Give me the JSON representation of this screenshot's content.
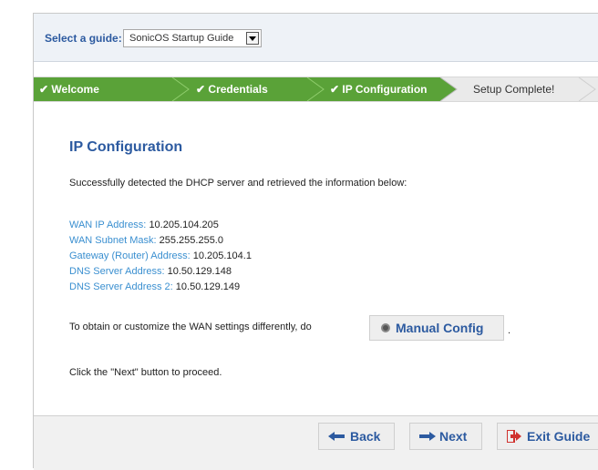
{
  "guide": {
    "label": "Select a guide:",
    "selected": "SonicOS Startup Guide"
  },
  "steps": [
    {
      "label": "Welcome",
      "status": "done"
    },
    {
      "label": "Credentials",
      "status": "done"
    },
    {
      "label": "IP Configuration",
      "status": "done"
    },
    {
      "label": "Setup Complete!",
      "status": "todo"
    }
  ],
  "check": "✔",
  "content": {
    "title": "IP Configuration",
    "intro": "Successfully detected the DHCP server and retrieved the information below:",
    "fields": [
      {
        "label": "WAN IP Address:",
        "value": "10.205.104.205"
      },
      {
        "label": "WAN Subnet Mask:",
        "value": "255.255.255.0"
      },
      {
        "label": "Gateway (Router) Address:",
        "value": "10.205.104.1"
      },
      {
        "label": "DNS Server Address:",
        "value": "10.50.129.148"
      },
      {
        "label": "DNS Server Address 2:",
        "value": "10.50.129.149"
      }
    ],
    "customize_text": "To obtain or customize the WAN settings differently, do",
    "manual_config_label": "Manual Config",
    "trailing_period": ".",
    "proceed_text": "Click the \"Next\" button to proceed."
  },
  "footer": {
    "back_label": "Back",
    "next_label": "Next",
    "exit_label": "Exit Guide"
  },
  "colors": {
    "accent_blue": "#2c5aa0",
    "step_done": "#5aa238",
    "link_blue": "#3a8fd0"
  }
}
